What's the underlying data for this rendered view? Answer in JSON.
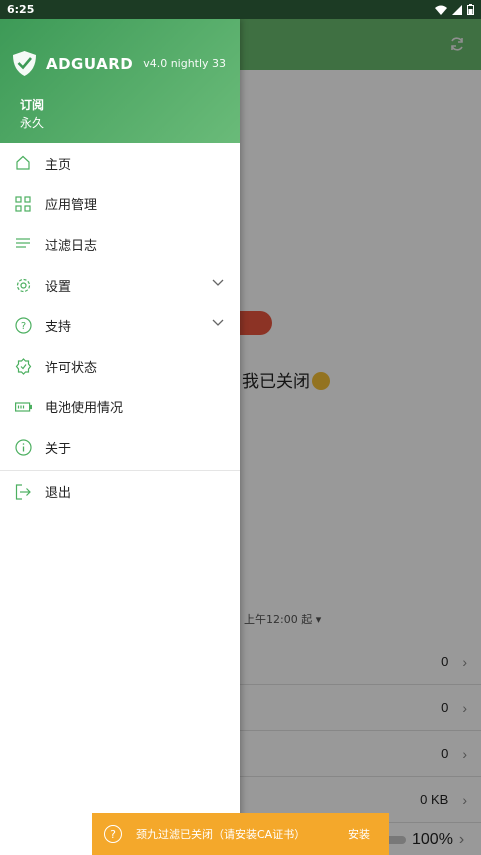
{
  "status_bar": {
    "time": "6:25"
  },
  "background": {
    "status_text": "我已关闭",
    "since": "上午12:00 起",
    "rows": [
      {
        "value": "0"
      },
      {
        "value": "0"
      },
      {
        "value": "0"
      },
      {
        "value": "0 KB"
      }
    ],
    "bottom_percent": "100%"
  },
  "drawer": {
    "brand": "ADGUARD",
    "version": "v4.0 nightly 33",
    "subscription_label": "订阅",
    "subscription_value": "永久",
    "items": [
      {
        "label": "主页",
        "icon": "home-icon"
      },
      {
        "label": "应用管理",
        "icon": "apps-grid-icon"
      },
      {
        "label": "过滤日志",
        "icon": "list-icon"
      },
      {
        "label": "设置",
        "icon": "gear-icon"
      },
      {
        "label": "支持",
        "icon": "help-icon"
      },
      {
        "label": "许可状态",
        "icon": "badge-icon"
      },
      {
        "label": "电池使用情况",
        "icon": "battery-icon"
      },
      {
        "label": "关于",
        "icon": "info-icon"
      }
    ],
    "logout_label": "退出"
  },
  "snackbar": {
    "message": "颈九过滤已关闭（请安装CA证书）",
    "action": "安装"
  },
  "colors": {
    "accent": "#3d9a57",
    "toggle_off": "#e9553f",
    "snackbar": "#f4a82b"
  }
}
